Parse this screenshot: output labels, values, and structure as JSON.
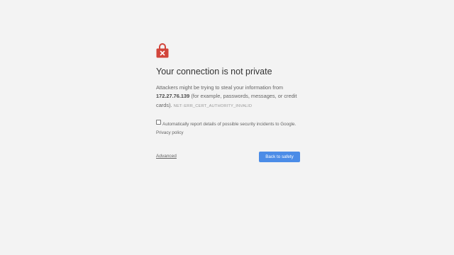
{
  "interstitial": {
    "icon": "lock-error-icon",
    "icon_color": "#d2453b",
    "heading": "Your connection is not private",
    "body_prefix": "Attackers might be trying to steal your information from",
    "host": "172.27.76.139",
    "body_suffix": " (for example, passwords, messages, or credit cards).",
    "error_code": "NET::ERR_CERT_AUTHORITY_INVALID",
    "report_text": "Automatically report details of possible security incidents to Google.",
    "privacy_link": "Privacy policy",
    "report_checked": false,
    "advanced_label": "Advanced",
    "back_button_label": "Back to safety",
    "button_color": "#4b8ce7"
  }
}
